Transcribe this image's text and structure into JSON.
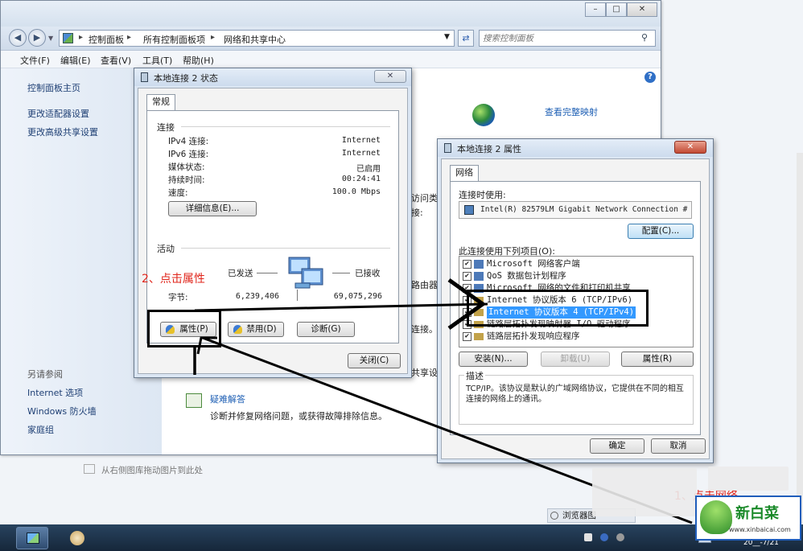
{
  "explorer": {
    "breadcrumb": [
      "控制面板",
      "所有控制面板项",
      "网络和共享中心"
    ],
    "search_placeholder": "搜索控制面板",
    "menu": [
      "文件(F)",
      "编辑(E)",
      "查看(V)",
      "工具(T)",
      "帮助(H)"
    ],
    "sidebar_links": [
      "控制面板主页",
      "更改适配器设置",
      "更改高级共享设置"
    ],
    "see_also_title": "另请参阅",
    "see_also": [
      "Internet 选项",
      "Windows 防火墙",
      "家庭组"
    ],
    "view_full_map": "查看完整映射",
    "troubleshoot_title": "疑难解答",
    "troubleshoot_desc": "诊断并修复网络问题，或获得故障排除信息。",
    "partial_text": [
      "访问类型",
      "接:",
      "路由器",
      "连接。",
      "共享设"
    ],
    "status_drop": "从右侧图库拖动图片到此处",
    "browser_tab": "浏览器图"
  },
  "status_dialog": {
    "title": "本地连接 2 状态",
    "tab": "常规",
    "connection_group": "连接",
    "fields": [
      {
        "label": "IPv4 连接:",
        "value": "Internet"
      },
      {
        "label": "IPv6 连接:",
        "value": "Internet"
      },
      {
        "label": "媒体状态:",
        "value": "已启用"
      },
      {
        "label": "持续时间:",
        "value": "00:24:41"
      },
      {
        "label": "速度:",
        "value": "100.0 Mbps"
      }
    ],
    "details_button": "详细信息(E)...",
    "activity_group": "活动",
    "sent_label": "已发送",
    "received_label": "已接收",
    "bytes_label": "字节:",
    "bytes_sent": "6,239,406",
    "bytes_received": "69,075,296",
    "properties_button": "属性(P)",
    "disable_button": "禁用(D)",
    "diagnose_button": "诊断(G)",
    "close_button": "关闭(C)"
  },
  "props_dialog": {
    "title": "本地连接 2 属性",
    "tab": "网络",
    "connect_using_label": "连接时使用:",
    "adapter": "Intel(R) 82579LM Gigabit Network Connection #",
    "configure_button": "配置(C)...",
    "items_label": "此连接使用下列项目(O):",
    "items": [
      {
        "label": "Microsoft 网络客户端",
        "checked": true,
        "selected": false
      },
      {
        "label": "QoS 数据包计划程序",
        "checked": true,
        "selected": false
      },
      {
        "label": "Microsoft 网络的文件和打印机共享",
        "checked": true,
        "selected": false
      },
      {
        "label": "Internet 协议版本 6 (TCP/IPv6)",
        "checked": true,
        "selected": false
      },
      {
        "label": "Internet 协议版本 4 (TCP/IPv4)",
        "checked": true,
        "selected": true
      },
      {
        "label": "链路层拓扑发现映射器 I/O 驱动程序",
        "checked": true,
        "selected": false
      },
      {
        "label": "链路层拓扑发现响应程序",
        "checked": true,
        "selected": false
      }
    ],
    "install_button": "安装(N)...",
    "uninstall_button": "卸载(U)",
    "properties_button": "属性(R)",
    "description_label": "描述",
    "description": "TCP/IP。该协议是默认的广域网络协议，它提供在不同的相互连接的网络上的通讯。",
    "ok_button": "确定",
    "cancel_button": "取消"
  },
  "annotations": {
    "step2": "2、点击属性",
    "step1": "1、点击网络"
  },
  "watermark": {
    "brand": "新白菜",
    "url": "www.xinbaicai.com"
  },
  "taskbar": {
    "clock_fragment": "20__-7/21"
  },
  "colors": {
    "annotation_red": "#e0251b",
    "selection_blue": "#3399ff",
    "link_blue": "#1e3f74"
  }
}
